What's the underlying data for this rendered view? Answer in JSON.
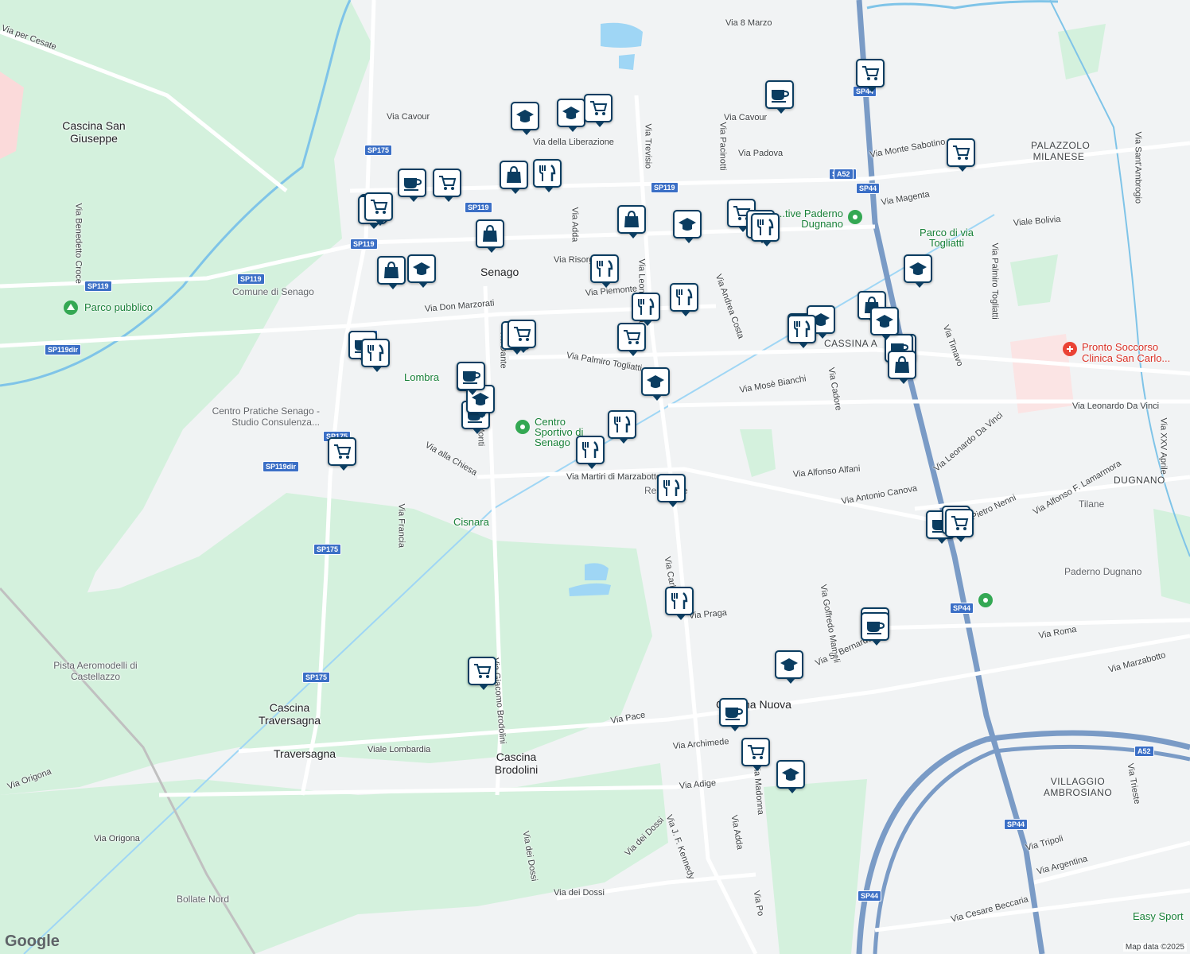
{
  "map": {
    "logo": "Google",
    "attribution": "Map data ©2025",
    "colors": {
      "land": "#f1f3f4",
      "park": "#d4f1dd",
      "water": "#9fd6f5",
      "highway": "#7a9bc6",
      "road": "#ffffff",
      "poi": "#0b3d61"
    },
    "places": [
      {
        "id": "senago",
        "text": "Senago"
      },
      {
        "id": "cascina-san-giuseppe",
        "text": "Cascina San Giuseppe"
      },
      {
        "id": "palazzolo",
        "text": "PALAZZOLO MILANESE"
      },
      {
        "id": "cassina-amata",
        "text": "CASSINA A"
      },
      {
        "id": "lombra",
        "text": "Lombra"
      },
      {
        "id": "cisnara",
        "text": "Cisnara"
      },
      {
        "id": "cascina-traversagna",
        "text": "Cascina Traversagna"
      },
      {
        "id": "traversagna",
        "text": "Traversagna"
      },
      {
        "id": "cascina-brodolini",
        "text": "Cascina Brodolini"
      },
      {
        "id": "cascina-nuova",
        "text": "Cascina Nuova"
      },
      {
        "id": "dugnano",
        "text": "DUGNANO"
      },
      {
        "id": "villaggio",
        "text": "VILLAGGIO AMBROSIANO"
      },
      {
        "id": "tilane",
        "text": "Tilane"
      },
      {
        "id": "paderno-dugnano",
        "text": "Paderno Dugnano"
      },
      {
        "id": "bollate-nord",
        "text": "Bollate Nord"
      },
      {
        "id": "pista",
        "text": "Pista Aeromodelli di Castellazzo"
      },
      {
        "id": "parco-pubblico",
        "text": "Parco pubblico"
      },
      {
        "id": "comune",
        "text": "Comune di Senago"
      },
      {
        "id": "centro-pratiche",
        "text": "Centro Pratiche Senago - Studio Consulenza..."
      },
      {
        "id": "centro-sportivo",
        "text": "Centro Sportivo di Senago"
      },
      {
        "id": "parco-togliatti",
        "text": "Parco di via Togliatti"
      },
      {
        "id": "paderno-green",
        "text": "...tive Paderno Dugnano"
      },
      {
        "id": "pronto-soccorso",
        "text": "Pronto Soccorso Clinica San Carlo..."
      },
      {
        "id": "easy-sport",
        "text": "Easy Sport"
      },
      {
        "id": "zampe",
        "text": "Re      zampe"
      }
    ],
    "streets": [
      "Via 8 Marzo",
      "Via per Cesate",
      "Via Cavour",
      "Via della Liberazione",
      "Via Trevisio",
      "Via Cavour",
      "Via Padova",
      "Via Monte Sabotino",
      "Via Magenta",
      "Viale Bolivia",
      "Via Sant'Ambrogio",
      "Via Benedetto Croce",
      "Via Adda",
      "Via Risorg",
      "Via Leonardo da Vinci",
      "Via Pacinotti",
      "Via Andrea Costa",
      "Via Piemonte",
      "Via Don Marzorati",
      "Via Palmiro Togliatti",
      "Via Palmiro Togliatti",
      "Via Timavo",
      "Via Mosè Bianchi",
      "Via Cadore",
      "Via Leonardo Da Vinci",
      "Via Leonardo Da Vinci",
      "Via XXV Aprile",
      "Via alla Chiesa",
      "Via Martiri di Marzabotto",
      "Via Alfonso Alfani",
      "Via Antonio Canova",
      "Via Pietro Nenni",
      "Via Alfonso F. Lamarmora",
      "Via Francia",
      "Via Carlo",
      "Via Praga",
      "Via Goffredo Mameli",
      "Via S. Bernardo",
      "Via Roma",
      "Via Marzabotto",
      "Via Giacomo Brodolini",
      "Via Pace",
      "Viale Lombardia",
      "Via Archimede",
      "Via Adige",
      "Via Madonna",
      "Via Adda",
      "Via Origona",
      "Via Origona",
      "Via dei Dossi",
      "Via dei Dossi",
      "Via dei Dossi",
      "Via J. F. Kennedy",
      "Via Po",
      "Via Trieste",
      "Via Tripoli",
      "Via Argentina",
      "Via Cesare Beccaria",
      "Via Monti",
      "Via Dante"
    ],
    "shields": [
      "SP175",
      "SP175",
      "SP119",
      "SP119",
      "SP119",
      "SP119",
      "SP119",
      "SP119dir",
      "SP119dir",
      "SP175",
      "SP175",
      "SP175",
      "SP175",
      "SP44",
      "SP44",
      "SP44",
      "SP44",
      "SP44",
      "A52",
      "A52"
    ],
    "poi_icons": [
      "cart",
      "school",
      "school",
      "cart",
      "cup",
      "bag",
      "bag",
      "cart",
      "cup",
      "bag",
      "bag",
      "cutlery",
      "bag",
      "cart",
      "school",
      "cart",
      "cutlery",
      "cutlery",
      "school",
      "bag",
      "school",
      "cutlery",
      "cutlery",
      "cutlery",
      "cutlery",
      "cart",
      "cart",
      "school",
      "cup",
      "school",
      "cup",
      "cup",
      "cutlery",
      "cutlery",
      "cutlery",
      "cart",
      "cutlery",
      "cutlery",
      "school",
      "cup",
      "cup",
      "cart",
      "school",
      "cup",
      "cart",
      "school",
      "cart",
      "bag",
      "cart",
      "school",
      "cart",
      "cup",
      "cup",
      "cart",
      "cart",
      "cup",
      "cart",
      "cutlery"
    ]
  }
}
